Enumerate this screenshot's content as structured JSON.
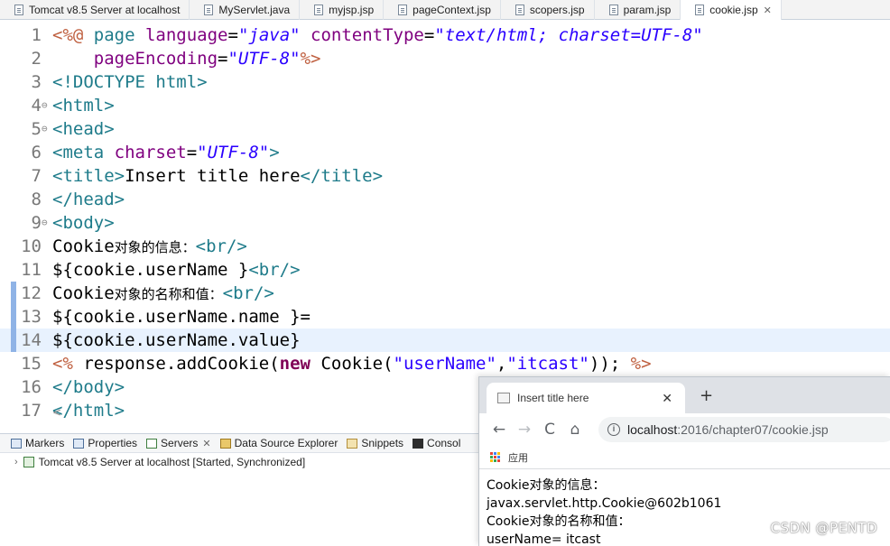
{
  "editor_tabs": [
    {
      "label": "Tomcat v8.5 Server at localhost"
    },
    {
      "label": "MyServlet.java"
    },
    {
      "label": "myjsp.jsp"
    },
    {
      "label": "pageContext.jsp"
    },
    {
      "label": "scopers.jsp"
    },
    {
      "label": "param.jsp"
    },
    {
      "label": "cookie.jsp",
      "active": true,
      "close": "✕"
    }
  ],
  "code": {
    "lines": [
      {
        "num": "1",
        "fold": "",
        "mark": false,
        "highlight": false,
        "tokens": [
          {
            "t": "<%@ ",
            "c": "jsp"
          },
          {
            "t": "page ",
            "c": "tag"
          },
          {
            "t": "language",
            "c": "attr"
          },
          {
            "t": "=",
            "c": "plain"
          },
          {
            "t": "\"java\"",
            "c": "val"
          },
          {
            "t": " contentType",
            "c": "attr"
          },
          {
            "t": "=",
            "c": "plain"
          },
          {
            "t": "\"text/html; charset=UTF-8\"",
            "c": "val"
          }
        ]
      },
      {
        "num": "2",
        "fold": "",
        "mark": false,
        "highlight": false,
        "tokens": [
          {
            "t": "    pageEncoding",
            "c": "attr"
          },
          {
            "t": "=",
            "c": "plain"
          },
          {
            "t": "\"UTF-8\"",
            "c": "val"
          },
          {
            "t": "%>",
            "c": "jsp"
          }
        ]
      },
      {
        "num": "3",
        "fold": "",
        "mark": false,
        "highlight": false,
        "tokens": [
          {
            "t": "<!DOCTYPE ",
            "c": "tag"
          },
          {
            "t": "html",
            "c": "tag"
          },
          {
            "t": ">",
            "c": "tag"
          }
        ]
      },
      {
        "num": "4",
        "fold": "⊖",
        "mark": false,
        "highlight": false,
        "tokens": [
          {
            "t": "<html>",
            "c": "tag"
          }
        ]
      },
      {
        "num": "5",
        "fold": "⊖",
        "mark": false,
        "highlight": false,
        "tokens": [
          {
            "t": "<head>",
            "c": "tag"
          }
        ]
      },
      {
        "num": "6",
        "fold": "",
        "mark": false,
        "highlight": false,
        "tokens": [
          {
            "t": "<meta ",
            "c": "tag"
          },
          {
            "t": "charset",
            "c": "attr"
          },
          {
            "t": "=",
            "c": "plain"
          },
          {
            "t": "\"UTF-8\"",
            "c": "val"
          },
          {
            "t": ">",
            "c": "tag"
          }
        ]
      },
      {
        "num": "7",
        "fold": "",
        "mark": false,
        "highlight": false,
        "tokens": [
          {
            "t": "<title>",
            "c": "tag"
          },
          {
            "t": "Insert title here",
            "c": "plain"
          },
          {
            "t": "</title>",
            "c": "tag"
          }
        ]
      },
      {
        "num": "8",
        "fold": "",
        "mark": false,
        "highlight": false,
        "tokens": [
          {
            "t": "</head>",
            "c": "tag"
          }
        ]
      },
      {
        "num": "9",
        "fold": "⊖",
        "mark": false,
        "highlight": false,
        "tokens": [
          {
            "t": "<body>",
            "c": "tag"
          }
        ]
      },
      {
        "num": "10",
        "fold": "",
        "mark": false,
        "highlight": false,
        "tokens": [
          {
            "t": "Cookie",
            "c": "plain"
          },
          {
            "t": "对象的信息：",
            "c": "cn"
          },
          {
            "t": "<br/>",
            "c": "tag"
          }
        ]
      },
      {
        "num": "11",
        "fold": "",
        "mark": false,
        "highlight": false,
        "tokens": [
          {
            "t": "${cookie.userName }",
            "c": "plain"
          },
          {
            "t": "<br/>",
            "c": "tag"
          }
        ]
      },
      {
        "num": "12",
        "fold": "",
        "mark": true,
        "highlight": false,
        "tokens": [
          {
            "t": "Cookie",
            "c": "plain"
          },
          {
            "t": "对象的名称和值：",
            "c": "cn"
          },
          {
            "t": "<br/>",
            "c": "tag"
          }
        ]
      },
      {
        "num": "13",
        "fold": "",
        "mark": true,
        "highlight": false,
        "tokens": [
          {
            "t": "${cookie.userName.name }=",
            "c": "plain"
          }
        ]
      },
      {
        "num": "14",
        "fold": "",
        "mark": true,
        "highlight": true,
        "tokens": [
          {
            "t": "${cookie.userName.value}",
            "c": "plain"
          }
        ]
      },
      {
        "num": "15",
        "fold": "",
        "mark": false,
        "highlight": false,
        "tokens": [
          {
            "t": "<% ",
            "c": "jsp"
          },
          {
            "t": "response.addCookie(",
            "c": "plain"
          },
          {
            "t": "new",
            "c": "kw"
          },
          {
            "t": " Cookie(",
            "c": "plain"
          },
          {
            "t": "\"userName\"",
            "c": "str"
          },
          {
            "t": ",",
            "c": "plain"
          },
          {
            "t": "\"itcast\"",
            "c": "str"
          },
          {
            "t": ")); ",
            "c": "plain"
          },
          {
            "t": "%>",
            "c": "jsp"
          }
        ]
      },
      {
        "num": "16",
        "fold": "",
        "mark": false,
        "highlight": false,
        "tokens": [
          {
            "t": "</body>",
            "c": "tag"
          }
        ]
      },
      {
        "num": "17",
        "fold": "",
        "mark": false,
        "highlight": false,
        "tokens": [
          {
            "t": "</html>",
            "c": "tag"
          }
        ]
      }
    ],
    "hscroll_left": "<"
  },
  "panels": {
    "tabs": [
      {
        "label": "Markers",
        "icon": "markers-icon",
        "cls": ""
      },
      {
        "label": "Properties",
        "icon": "properties-icon",
        "cls": ""
      },
      {
        "label": "Servers",
        "icon": "servers-icon",
        "cls": "srv",
        "close": "✕"
      },
      {
        "label": "Data Source Explorer",
        "icon": "database-icon",
        "cls": "db"
      },
      {
        "label": "Snippets",
        "icon": "snippets-icon",
        "cls": "snip"
      },
      {
        "label": "Consol",
        "icon": "console-icon",
        "cls": "con"
      }
    ],
    "server_entry": "Tomcat v8.5 Server at localhost  [Started, Synchronized]",
    "expand_arrow": "›"
  },
  "browser": {
    "tab_title": "Insert title here",
    "tab_close": "✕",
    "new_tab": "+",
    "nav": {
      "back": "←",
      "forward": "→",
      "reload": "C",
      "home": "⌂"
    },
    "url_info": "i",
    "url_host": "localhost",
    "url_path": ":2016/chapter07/cookie.jsp",
    "bookmark_apps": "应用",
    "content_lines": [
      "Cookie对象的信息：",
      "javax.servlet.http.Cookie@602b1061",
      "Cookie对象的名称和值：",
      "userName= itcast"
    ]
  },
  "watermark": "CSDN @PENTD"
}
